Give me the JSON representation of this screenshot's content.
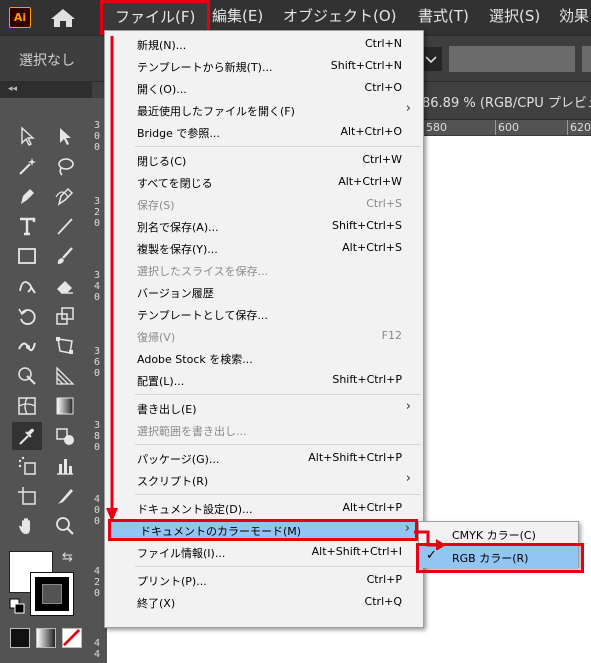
{
  "app": {
    "logo": "Ai"
  },
  "menubar": {
    "items": [
      "ファイル(F)",
      "編集(E)",
      "オブジェクト(O)",
      "書式(T)",
      "選択(S)",
      "効果"
    ]
  },
  "controlbar": {
    "selection_label": "選択なし"
  },
  "document": {
    "tab_info": "86.89 % (RGB/CPU プレビュ",
    "h_ruler": [
      "580",
      "600",
      "620"
    ],
    "v_ruler": [
      "300",
      "320",
      "340",
      "360",
      "380",
      "400",
      "420",
      "44"
    ]
  },
  "file_menu": {
    "items": [
      {
        "label": "新規(N)...",
        "shortcut": "Ctrl+N",
        "disabled": false
      },
      {
        "label": "テンプレートから新規(T)...",
        "shortcut": "Shift+Ctrl+N",
        "disabled": false
      },
      {
        "label": "開く(O)...",
        "shortcut": "Ctrl+O",
        "disabled": false
      },
      {
        "label": "最近使用したファイルを開く(F)",
        "shortcut": "",
        "submenu": true,
        "disabled": false
      },
      {
        "label": "Bridge で参照...",
        "shortcut": "Alt+Ctrl+O",
        "disabled": false
      },
      {
        "label": "閉じる(C)",
        "shortcut": "Ctrl+W",
        "disabled": false
      },
      {
        "label": "すべてを閉じる",
        "shortcut": "Alt+Ctrl+W",
        "disabled": false
      },
      {
        "label": "保存(S)",
        "shortcut": "Ctrl+S",
        "disabled": true
      },
      {
        "label": "別名で保存(A)...",
        "shortcut": "Shift+Ctrl+S",
        "disabled": false
      },
      {
        "label": "複製を保存(Y)...",
        "shortcut": "Alt+Ctrl+S",
        "disabled": false
      },
      {
        "label": "選択したスライスを保存...",
        "shortcut": "",
        "disabled": true
      },
      {
        "label": "バージョン履歴",
        "shortcut": "",
        "disabled": false
      },
      {
        "label": "テンプレートとして保存...",
        "shortcut": "",
        "disabled": false
      },
      {
        "label": "復帰(V)",
        "shortcut": "F12",
        "disabled": true
      },
      {
        "label": "Adobe Stock を検索...",
        "shortcut": "",
        "disabled": false
      },
      {
        "label": "配置(L)...",
        "shortcut": "Shift+Ctrl+P",
        "disabled": false
      },
      {
        "label": "書き出し(E)",
        "shortcut": "",
        "submenu": true,
        "disabled": false
      },
      {
        "label": "選択範囲を書き出し...",
        "shortcut": "",
        "disabled": true
      },
      {
        "label": "パッケージ(G)...",
        "shortcut": "Alt+Shift+Ctrl+P",
        "disabled": false
      },
      {
        "label": "スクリプト(R)",
        "shortcut": "",
        "submenu": true,
        "disabled": false
      },
      {
        "label": "ドキュメント設定(D)...",
        "shortcut": "Alt+Ctrl+P",
        "disabled": false
      },
      {
        "label": "ドキュメントのカラーモード(M)",
        "shortcut": "",
        "submenu": true,
        "disabled": false,
        "highlighted": true
      },
      {
        "label": "ファイル情報(I)...",
        "shortcut": "Alt+Shift+Ctrl+I",
        "disabled": false
      },
      {
        "label": "プリント(P)...",
        "shortcut": "Ctrl+P",
        "disabled": false
      },
      {
        "label": "終了(X)",
        "shortcut": "Ctrl+Q",
        "disabled": false
      }
    ]
  },
  "color_mode_submenu": {
    "items": [
      {
        "label": "CMYK カラー(C)",
        "checked": false
      },
      {
        "label": "RGB カラー(R)",
        "checked": true
      }
    ],
    "check_mark": "✓"
  },
  "colors": {
    "highlight": "#92c5f2",
    "annotation": "#e60012",
    "menubar_bg": "#323232",
    "toolbar_bg": "#535353"
  }
}
